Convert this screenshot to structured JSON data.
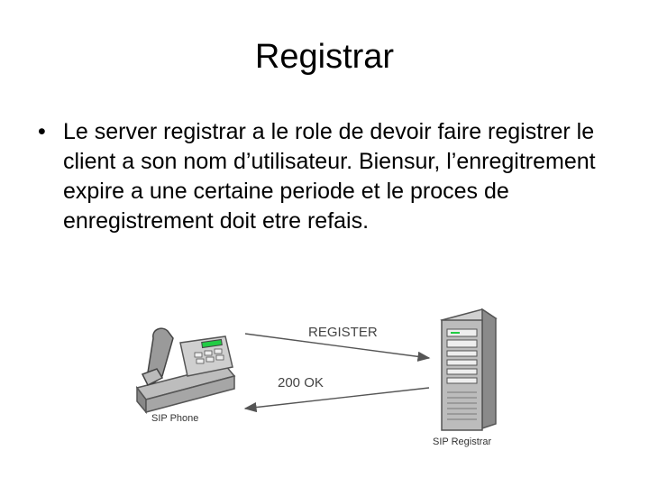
{
  "slide": {
    "title": "Registrar",
    "bullet_symbol": "•",
    "bullet_text": "Le server registrar a le role de devoir faire registrer le client a son nom d’utilisateur. Biensur, l’enregitrement expire a une certaine periode et le proces de enregistrement doit etre refais."
  },
  "diagram": {
    "phone_label": "SIP Phone",
    "server_label": "SIP Registrar",
    "request_label": "REGISTER",
    "response_label": "200 OK"
  },
  "colors": {
    "text": "#000000",
    "device_gray": "#9a9a9a",
    "device_dark": "#555555",
    "phone_display": "#22cc44",
    "arrow": "#555555"
  }
}
